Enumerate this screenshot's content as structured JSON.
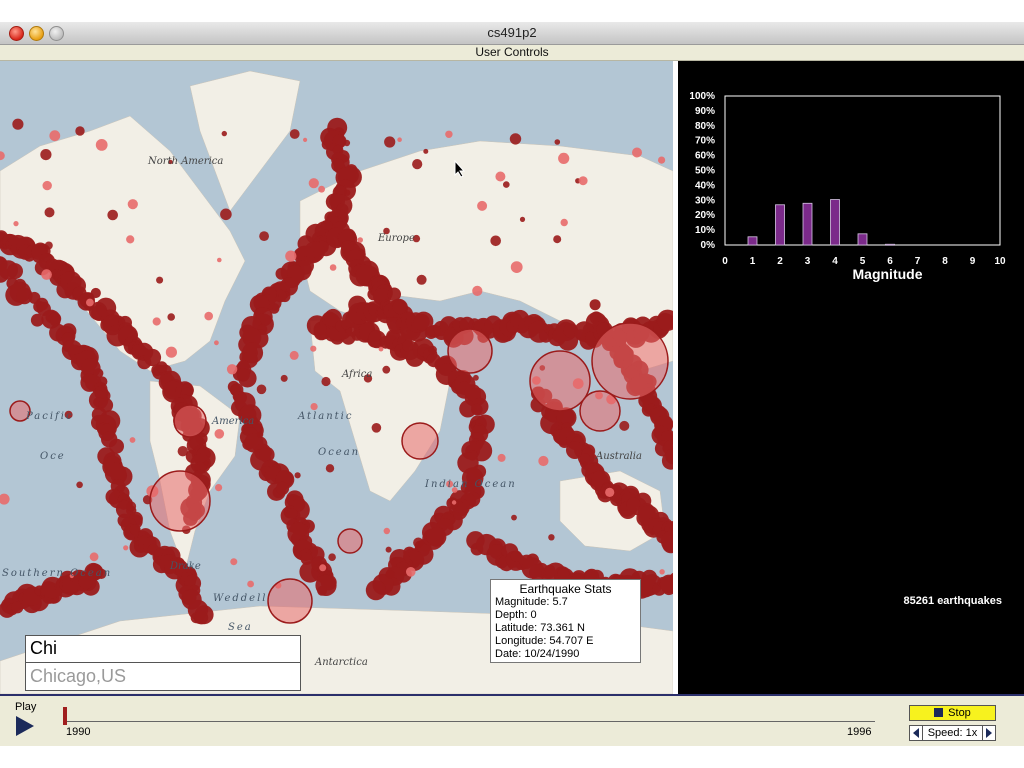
{
  "window": {
    "title": "cs491p2",
    "menu_label": "User Controls"
  },
  "map": {
    "labels": {
      "north_america": "North America",
      "europe": "Europe",
      "africa": "Africa",
      "america": "America",
      "pacific": "Pacific",
      "ocean_left": "Oce",
      "atlantic": "Atlantic",
      "ocean_atl": "Ocean",
      "indian_ocean": "Indian Ocean",
      "australia": "Australia",
      "southern_ocean": "Southern Ocean",
      "drake": "Drake",
      "weddell": "Weddell",
      "sea": "Sea",
      "antarctica": "Antarctica"
    },
    "marker_color": "#9b1b1b",
    "marker_light_color": "#e86a6a"
  },
  "stats": {
    "title": "Earthquake Stats",
    "magnitude": "Magnitude: 5.7",
    "depth": "Depth: 0",
    "latitude": "Latitude: 73.361 N",
    "longitude": "Longitude: 54.707 E",
    "date": "Date: 10/24/1990"
  },
  "search": {
    "query": "Chi",
    "suggestion": "Chicago,US"
  },
  "chart_data": {
    "type": "bar",
    "xlabel": "Magnitude",
    "x_ticks": [
      "0",
      "1",
      "2",
      "3",
      "4",
      "5",
      "6",
      "7",
      "8",
      "9",
      "10"
    ],
    "y_ticks": [
      "0%",
      "10%",
      "20%",
      "30%",
      "40%",
      "50%",
      "60%",
      "70%",
      "80%",
      "90%",
      "100%"
    ],
    "categories": [
      1,
      2,
      3,
      4,
      5,
      6
    ],
    "values": [
      5.5,
      27,
      28,
      30.5,
      7.5,
      0.5
    ],
    "ylim": [
      0,
      100
    ],
    "xlim": [
      0,
      10
    ],
    "bar_color": "#7b2a8a"
  },
  "panel": {
    "count_text": "85261 earthquakes"
  },
  "controls": {
    "play_label": "Play",
    "year_start": "1990",
    "year_end": "1996",
    "stop_label": "Stop",
    "speed_label": "Speed: 1x",
    "timeline_progress": 0
  }
}
